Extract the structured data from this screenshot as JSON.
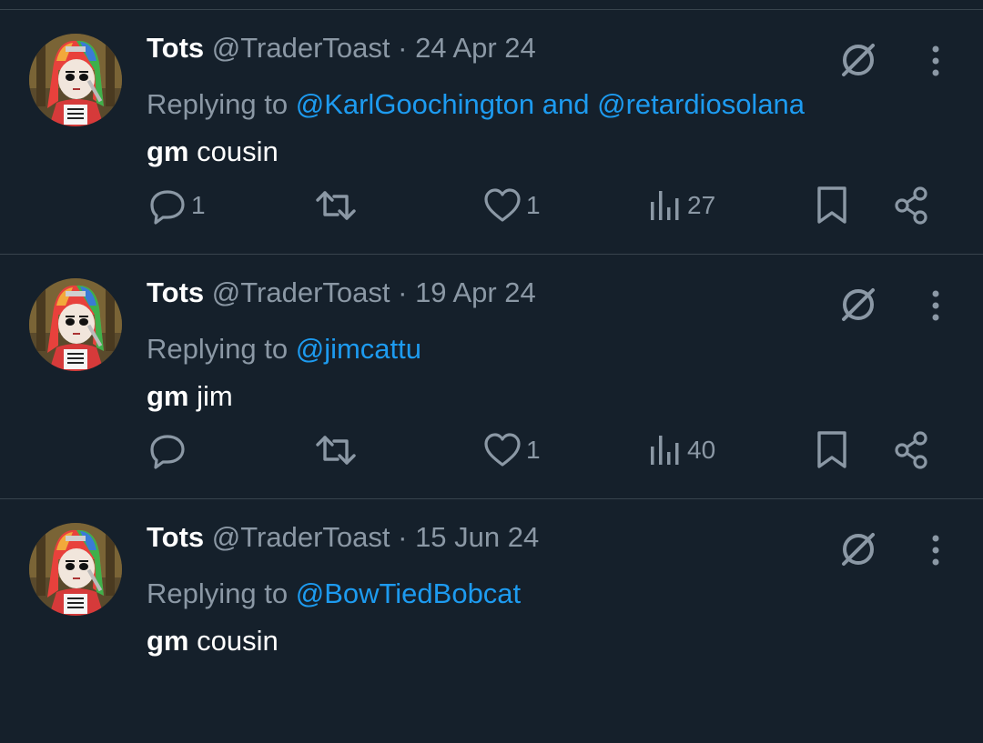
{
  "colors": {
    "background": "#15202b",
    "divider": "#38444d",
    "text_primary": "#ffffff",
    "text_secondary": "#8b98a5",
    "link": "#1d9bf0"
  },
  "icons": {
    "reply": "reply-icon",
    "repost": "repost-icon",
    "like": "heart-icon",
    "views": "views-icon",
    "bookmark": "bookmark-icon",
    "share": "share-icon",
    "grok": "grok-icon",
    "more": "more-icon"
  },
  "tweets": [
    {
      "name": "Tots",
      "handle": "@TraderToast",
      "separator": "·",
      "date": "24 Apr 24",
      "replying_prefix": "Replying to",
      "mention_1": "@KarlGoochington",
      "mention_join": "and",
      "mention_2": "@retardiosolana",
      "body_bold": "gm",
      "body_rest": "cousin",
      "replies": "1",
      "reposts": "",
      "likes": "1",
      "views": "27"
    },
    {
      "name": "Tots",
      "handle": "@TraderToast",
      "separator": "·",
      "date": "19 Apr 24",
      "replying_prefix": "Replying to",
      "mention_1": "@jimcattu",
      "body_bold": "gm",
      "body_rest": "jim",
      "replies": "",
      "reposts": "",
      "likes": "1",
      "views": "40"
    },
    {
      "name": "Tots",
      "handle": "@TraderToast",
      "separator": "·",
      "date": "15 Jun 24",
      "replying_prefix": "Replying to",
      "mention_1": "@BowTiedBobcat",
      "body_bold": "gm",
      "body_rest": "cousin"
    }
  ]
}
